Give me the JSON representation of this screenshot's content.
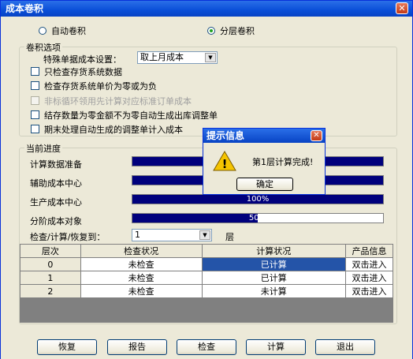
{
  "window": {
    "title": "成本卷积",
    "close_glyph": "✕"
  },
  "mode": {
    "option_auto": "自动卷积",
    "option_layered": "分层卷积",
    "selected": "分层卷积"
  },
  "options_group": {
    "title": "卷积选项",
    "special_cost_label": "特殊单据成本设置：",
    "special_cost_value": "取上月成本",
    "checkboxes": [
      {
        "label": "只检查存货系统数据",
        "enabled": true,
        "checked": false
      },
      {
        "label": "检查存货系统单价为零或为负",
        "enabled": true,
        "checked": false
      },
      {
        "label": "非标循环领用先计算对应标准订单成本",
        "enabled": false,
        "checked": false
      },
      {
        "label": "结存数量为零金额不为零自动生成出库调整单",
        "enabled": true,
        "checked": false
      },
      {
        "label": "期末处理自动生成的调整单计入成本",
        "enabled": true,
        "checked": false
      }
    ]
  },
  "progress_group": {
    "title": "当前进度",
    "rows": [
      {
        "label": "计算数据准备",
        "percent": 100,
        "percent_text": ""
      },
      {
        "label": "辅助成本中心",
        "percent": 100,
        "percent_text": ""
      },
      {
        "label": "生产成本中心",
        "percent": 100,
        "percent_text": "100%"
      },
      {
        "label": "分阶成本对象",
        "percent": 50,
        "percent_text": "50%"
      }
    ],
    "check_to_label": "检查/计算/恢复到：",
    "check_to_value": "1",
    "layer_suffix": "层"
  },
  "table": {
    "headers": [
      "层次",
      "检查状况",
      "计算状况",
      "产品信息"
    ],
    "rows": [
      {
        "level": "0",
        "check": "未检查",
        "calc": "已计算",
        "info": "双击进入"
      },
      {
        "level": "1",
        "check": "未检查",
        "calc": "已计算",
        "info": "双击进入"
      },
      {
        "level": "2",
        "check": "未检查",
        "calc": "未计算",
        "info": "双击进入"
      }
    ]
  },
  "buttons": {
    "restore": "恢复",
    "report": "报告",
    "check": "检查",
    "calc": "计算",
    "exit": "退出"
  },
  "dialog": {
    "title": "提示信息",
    "close_glyph": "✕",
    "warning_glyph": "!",
    "message": "第1层计算完成!",
    "ok_label": "确定"
  },
  "colors": {
    "titlebar": "#0a4fd8",
    "progress_fill": "#00007c",
    "selection": "#2454a8",
    "warning": "#f5c400"
  }
}
